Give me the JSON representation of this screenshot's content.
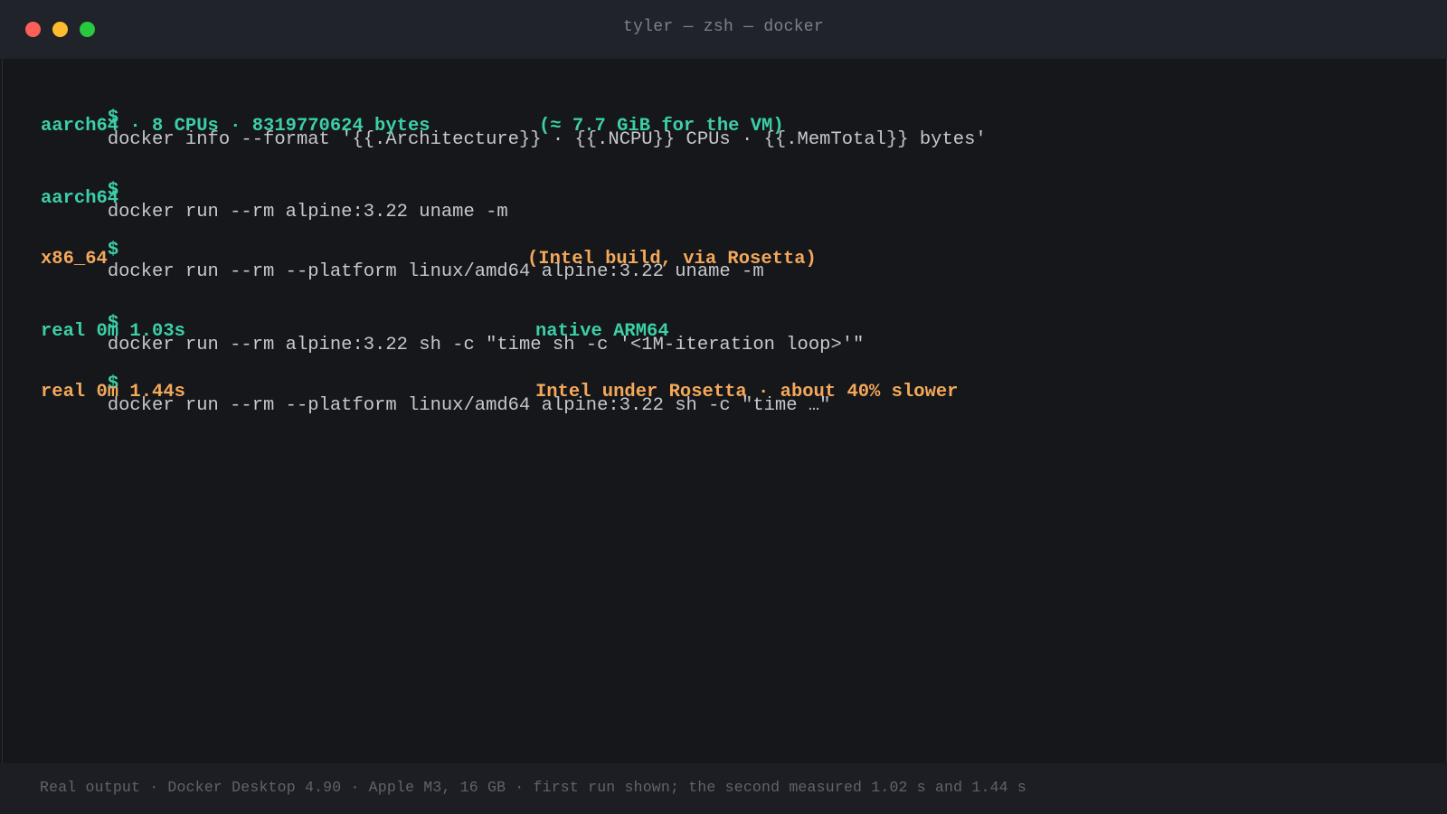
{
  "window": {
    "title": "tyler — zsh — docker"
  },
  "terminal": {
    "prompt_symbol": "$",
    "lines": [
      {
        "cmd": "docker info --format '{{.Architecture}} · {{.NCPU}} CPUs · {{.MemTotal}} bytes'"
      },
      {
        "out": "aarch64 · 8 CPUs · 8319770624 bytes",
        "note": "(≈ 7.7 GiB for the VM)"
      },
      {
        "cmd": "docker run --rm alpine:3.22 uname -m"
      },
      {
        "out": "aarch64"
      },
      {
        "cmd": "docker run --rm --platform linux/amd64 alpine:3.22 uname -m"
      },
      {
        "out": "x86_64",
        "note": "(Intel build, via Rosetta)"
      },
      {
        "cmd": "docker run --rm alpine:3.22 sh -c \"time sh -c '<1M-iteration loop>'\""
      },
      {
        "out": "real 0m 1.03s",
        "note": "native ARM64"
      },
      {
        "cmd": "docker run --rm --platform linux/amd64 alpine:3.22 sh -c \"time …\""
      },
      {
        "out": "real 0m 1.44s",
        "note": "Intel under Rosetta · about 40% slower"
      }
    ]
  },
  "footer": {
    "text": "Real output · Docker Desktop 4.90 · Apple M3, 16 GB · first run shown; the second measured 1.02 s and 1.44 s"
  },
  "colors": {
    "prompt": "#3ccfa8",
    "output_native": "#3ccfa8",
    "output_rosetta": "#f4a85a",
    "command_text": "#c6c8cb",
    "background": "#15171b"
  }
}
